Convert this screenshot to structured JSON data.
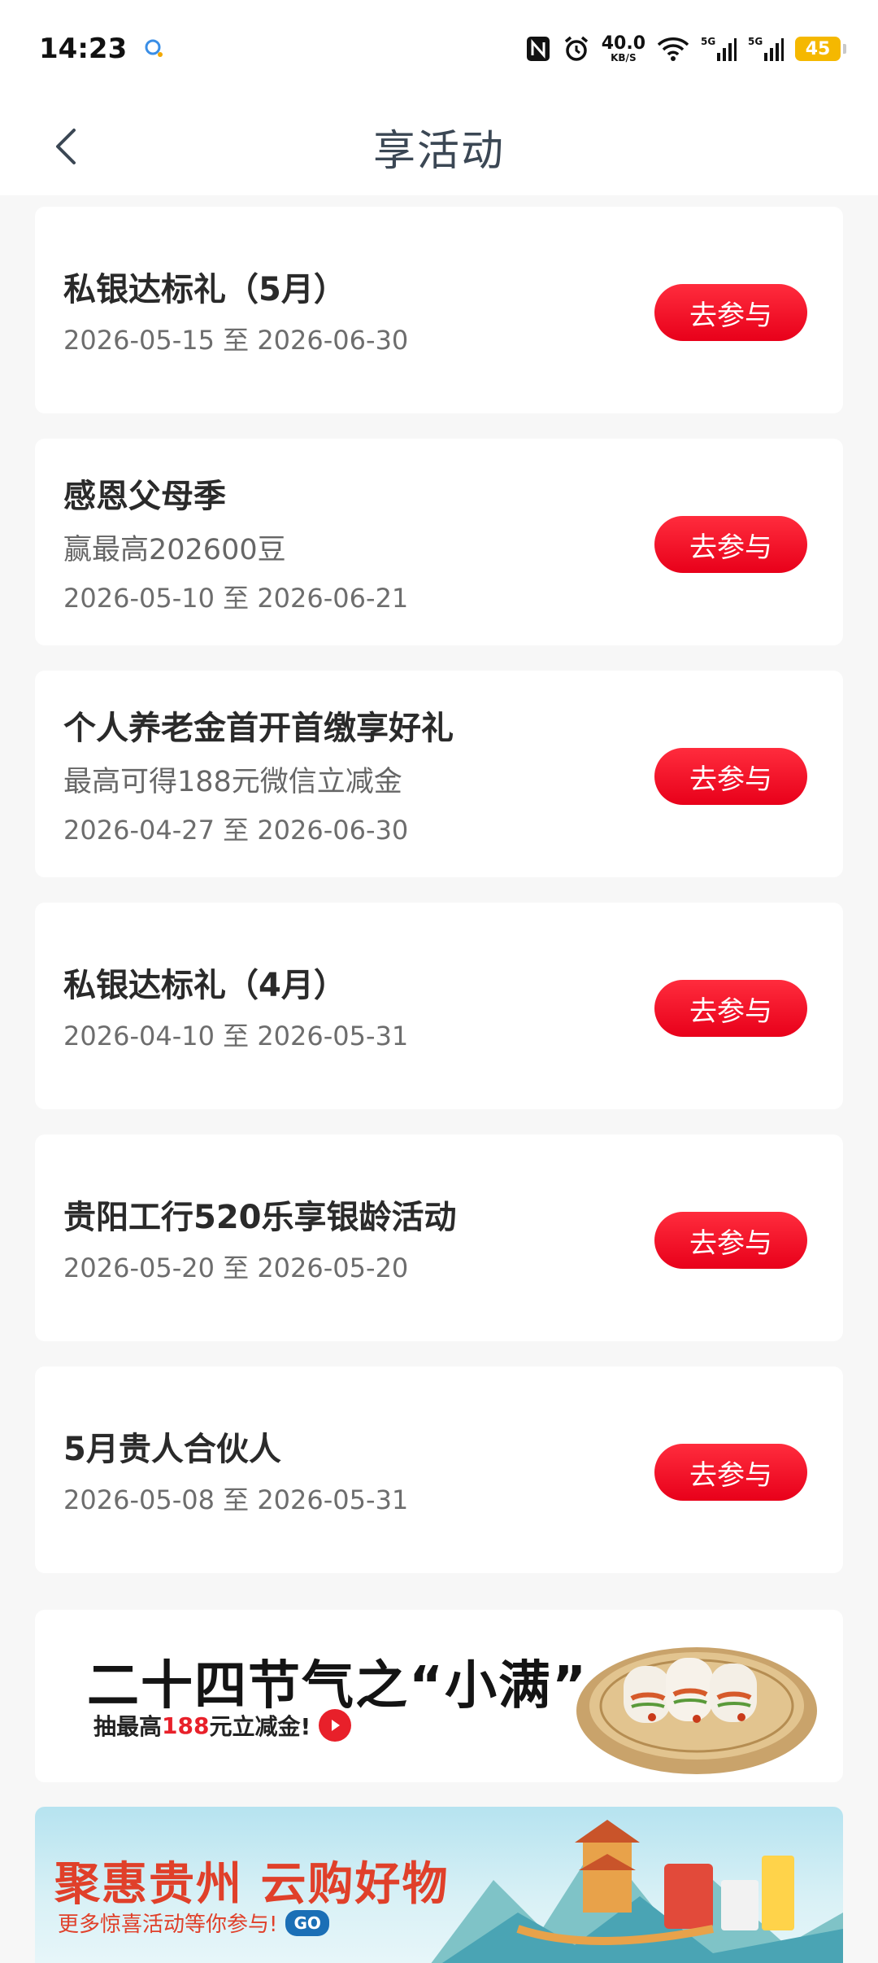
{
  "status_bar": {
    "time": "14:23",
    "net_speed_value": "40.0",
    "net_speed_unit": "KB/S",
    "battery": "45",
    "signal1": "5G",
    "signal2": "5G"
  },
  "header": {
    "title": "享活动"
  },
  "join_label": "去参与",
  "activities": [
    {
      "title": "私银达标礼（5月）",
      "subtitle": "",
      "date": "2026-05-15 至 2026-06-30"
    },
    {
      "title": "感恩父母季",
      "subtitle": "赢最高202600豆",
      "date": "2026-05-10 至 2026-06-21"
    },
    {
      "title": "个人养老金首开首缴享好礼",
      "subtitle": "最高可得188元微信立减金",
      "date": "2026-04-27 至 2026-06-30"
    },
    {
      "title": "私银达标礼（4月）",
      "subtitle": "",
      "date": "2026-04-10 至 2026-05-31"
    },
    {
      "title": "贵阳工行520乐享银龄活动",
      "subtitle": "",
      "date": "2026-05-20 至 2026-05-20"
    },
    {
      "title": "5月贵人合伙人",
      "subtitle": "",
      "date": "2026-05-08 至 2026-05-31"
    }
  ],
  "banner1": {
    "title": "二十四节气之“小满”",
    "sub_prefix": "抽最高",
    "sub_amount": "188",
    "sub_suffix": "元立减金!"
  },
  "banner2": {
    "title": "聚惠贵州 云购好物",
    "sub": "更多惊喜活动等你参与!",
    "go": "GO"
  },
  "colors": {
    "accent_red": "#e8001a",
    "title_gray": "#3b4754"
  }
}
